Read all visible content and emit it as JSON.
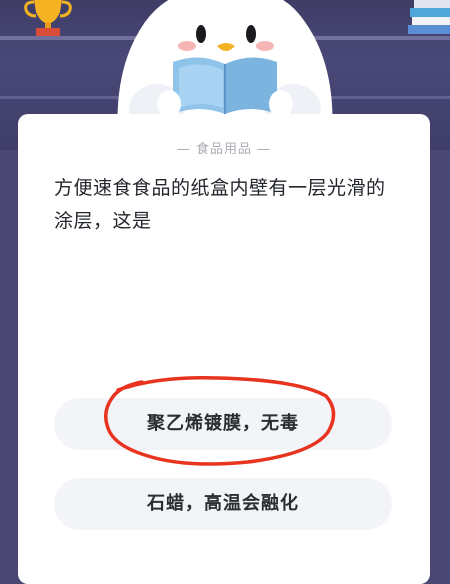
{
  "quiz": {
    "category": "— 食品用品 —",
    "question": "方便速食食品的纸盒内壁有一层光滑的涂层，这是",
    "options": [
      {
        "label": "聚乙烯镀膜，无毒",
        "marked": true
      },
      {
        "label": "石蜡，高温会融化",
        "marked": false
      }
    ]
  },
  "colors": {
    "header_bg": "#4a4872",
    "card_bg": "#ffffff",
    "option_bg": "#f2f4f7",
    "circle_mark": "#e8331f",
    "mascot_book": "#8fc3ea"
  },
  "icons": [
    "trophy-icon",
    "books-icon",
    "mascot-illustration"
  ]
}
